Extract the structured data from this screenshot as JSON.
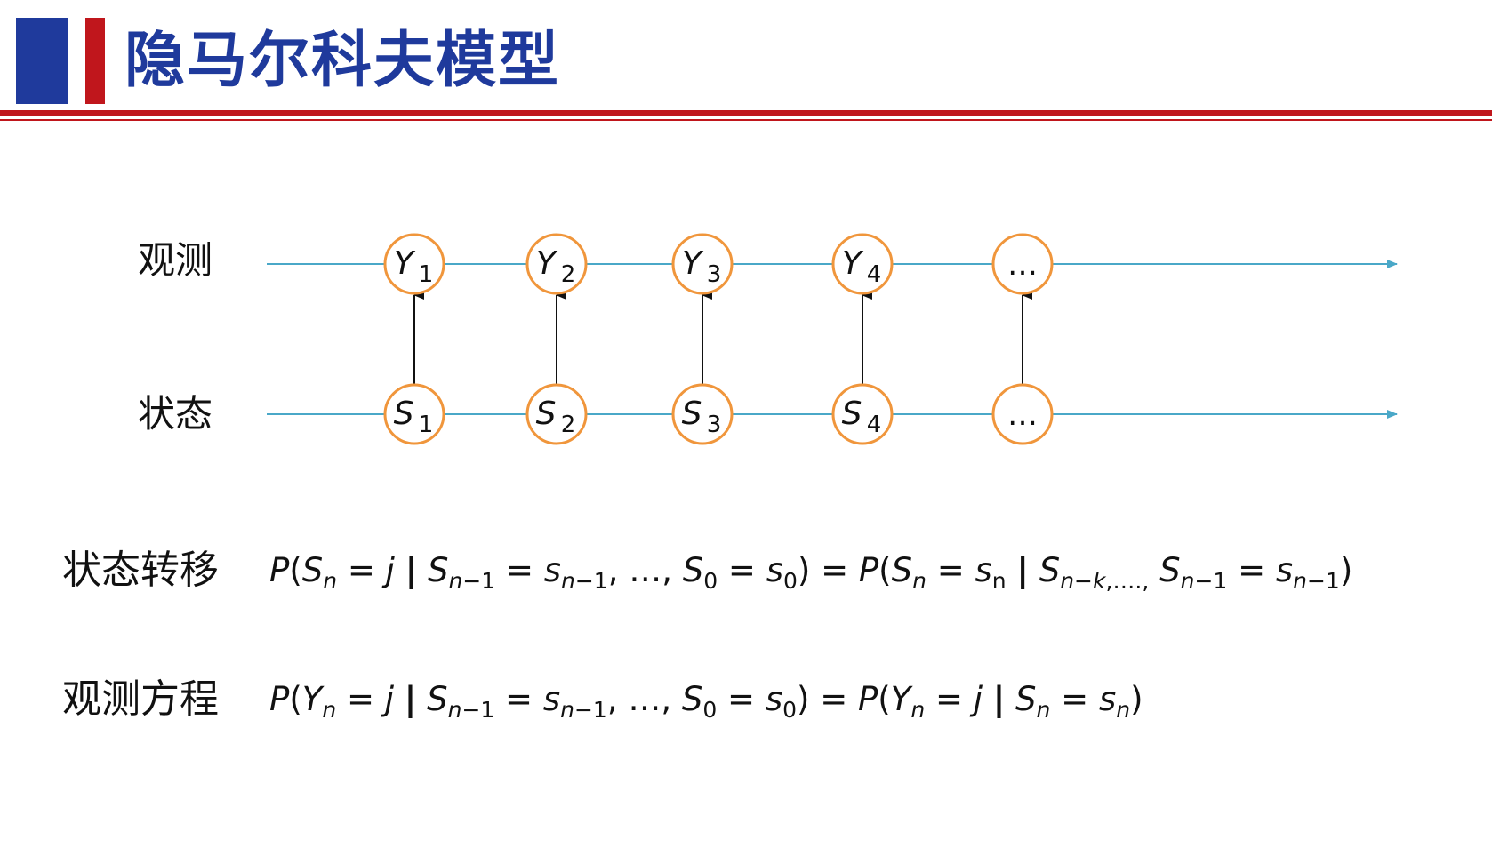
{
  "header": {
    "title": "隐马尔科夫模型",
    "colors": {
      "blue": "#1f3a9c",
      "red": "#c0161c"
    }
  },
  "diagram": {
    "rows": {
      "observation_label": "观测",
      "state_label": "状态"
    },
    "observations": [
      {
        "base": "Y",
        "sub": "1"
      },
      {
        "base": "Y",
        "sub": "2"
      },
      {
        "base": "Y",
        "sub": "3"
      },
      {
        "base": "Y",
        "sub": "4"
      },
      {
        "base": "…",
        "sub": ""
      }
    ],
    "states": [
      {
        "base": "S",
        "sub": "1"
      },
      {
        "base": "S",
        "sub": "2"
      },
      {
        "base": "S",
        "sub": "3"
      },
      {
        "base": "S",
        "sub": "4"
      },
      {
        "base": "…",
        "sub": ""
      }
    ],
    "colors": {
      "node_stroke": "#f0963c",
      "timeline": "#4aa8c8",
      "arrow": "#111111"
    }
  },
  "equations": {
    "transition": {
      "label": "状态转移",
      "formula": "P(Sn = j | Sn−1 = sn−1, …, S0 = s0) = P(Sn = sn | Sn−k,…., Sn−1 = sn−1)"
    },
    "observation": {
      "label": "观测方程",
      "formula": "P(Yn = j | Sn−1 = sn−1, …, S0 = s0) = P(Yn = j | Sn = sn)"
    }
  }
}
